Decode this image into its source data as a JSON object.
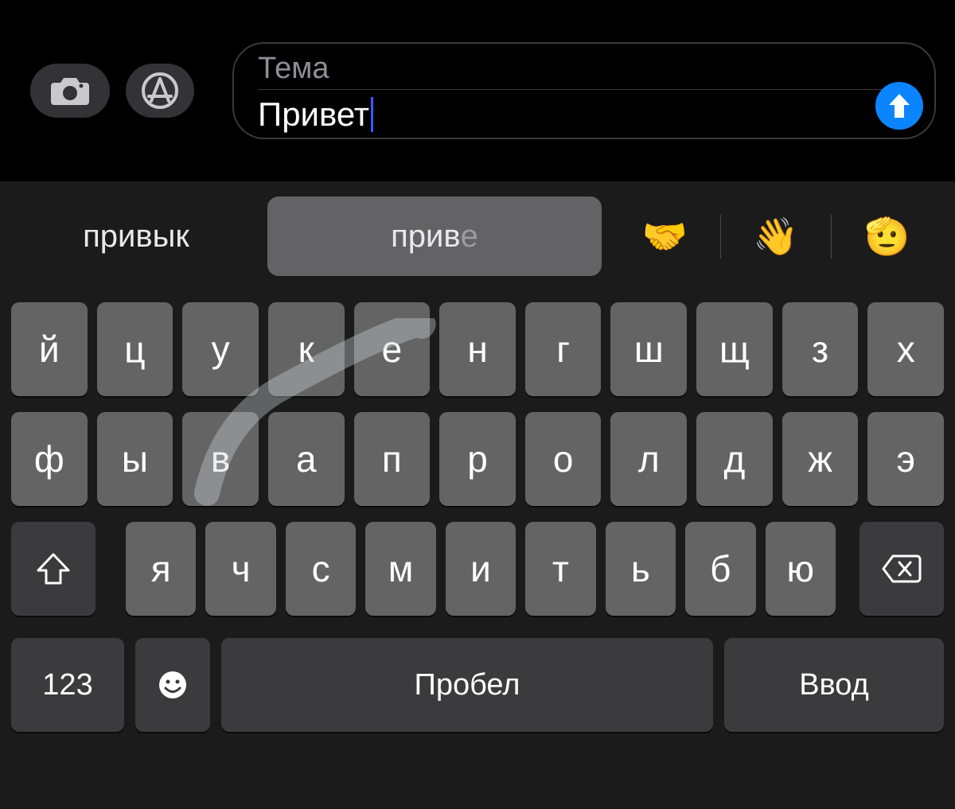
{
  "compose": {
    "subject_placeholder": "Тема",
    "message_text": "Привет"
  },
  "suggestions": {
    "left": "привык",
    "center_typed": "прив",
    "center_ghost": "е",
    "emojis": [
      "🤝",
      "👋",
      "🫡"
    ]
  },
  "keyboard": {
    "row1": [
      "й",
      "ц",
      "у",
      "к",
      "е",
      "н",
      "г",
      "ш",
      "щ",
      "з",
      "х"
    ],
    "row2": [
      "ф",
      "ы",
      "в",
      "а",
      "п",
      "р",
      "о",
      "л",
      "д",
      "ж",
      "э"
    ],
    "row3": [
      "я",
      "ч",
      "с",
      "м",
      "и",
      "т",
      "ь",
      "б",
      "ю"
    ],
    "numbers_label": "123",
    "space_label": "Пробел",
    "enter_label": "Ввод"
  }
}
